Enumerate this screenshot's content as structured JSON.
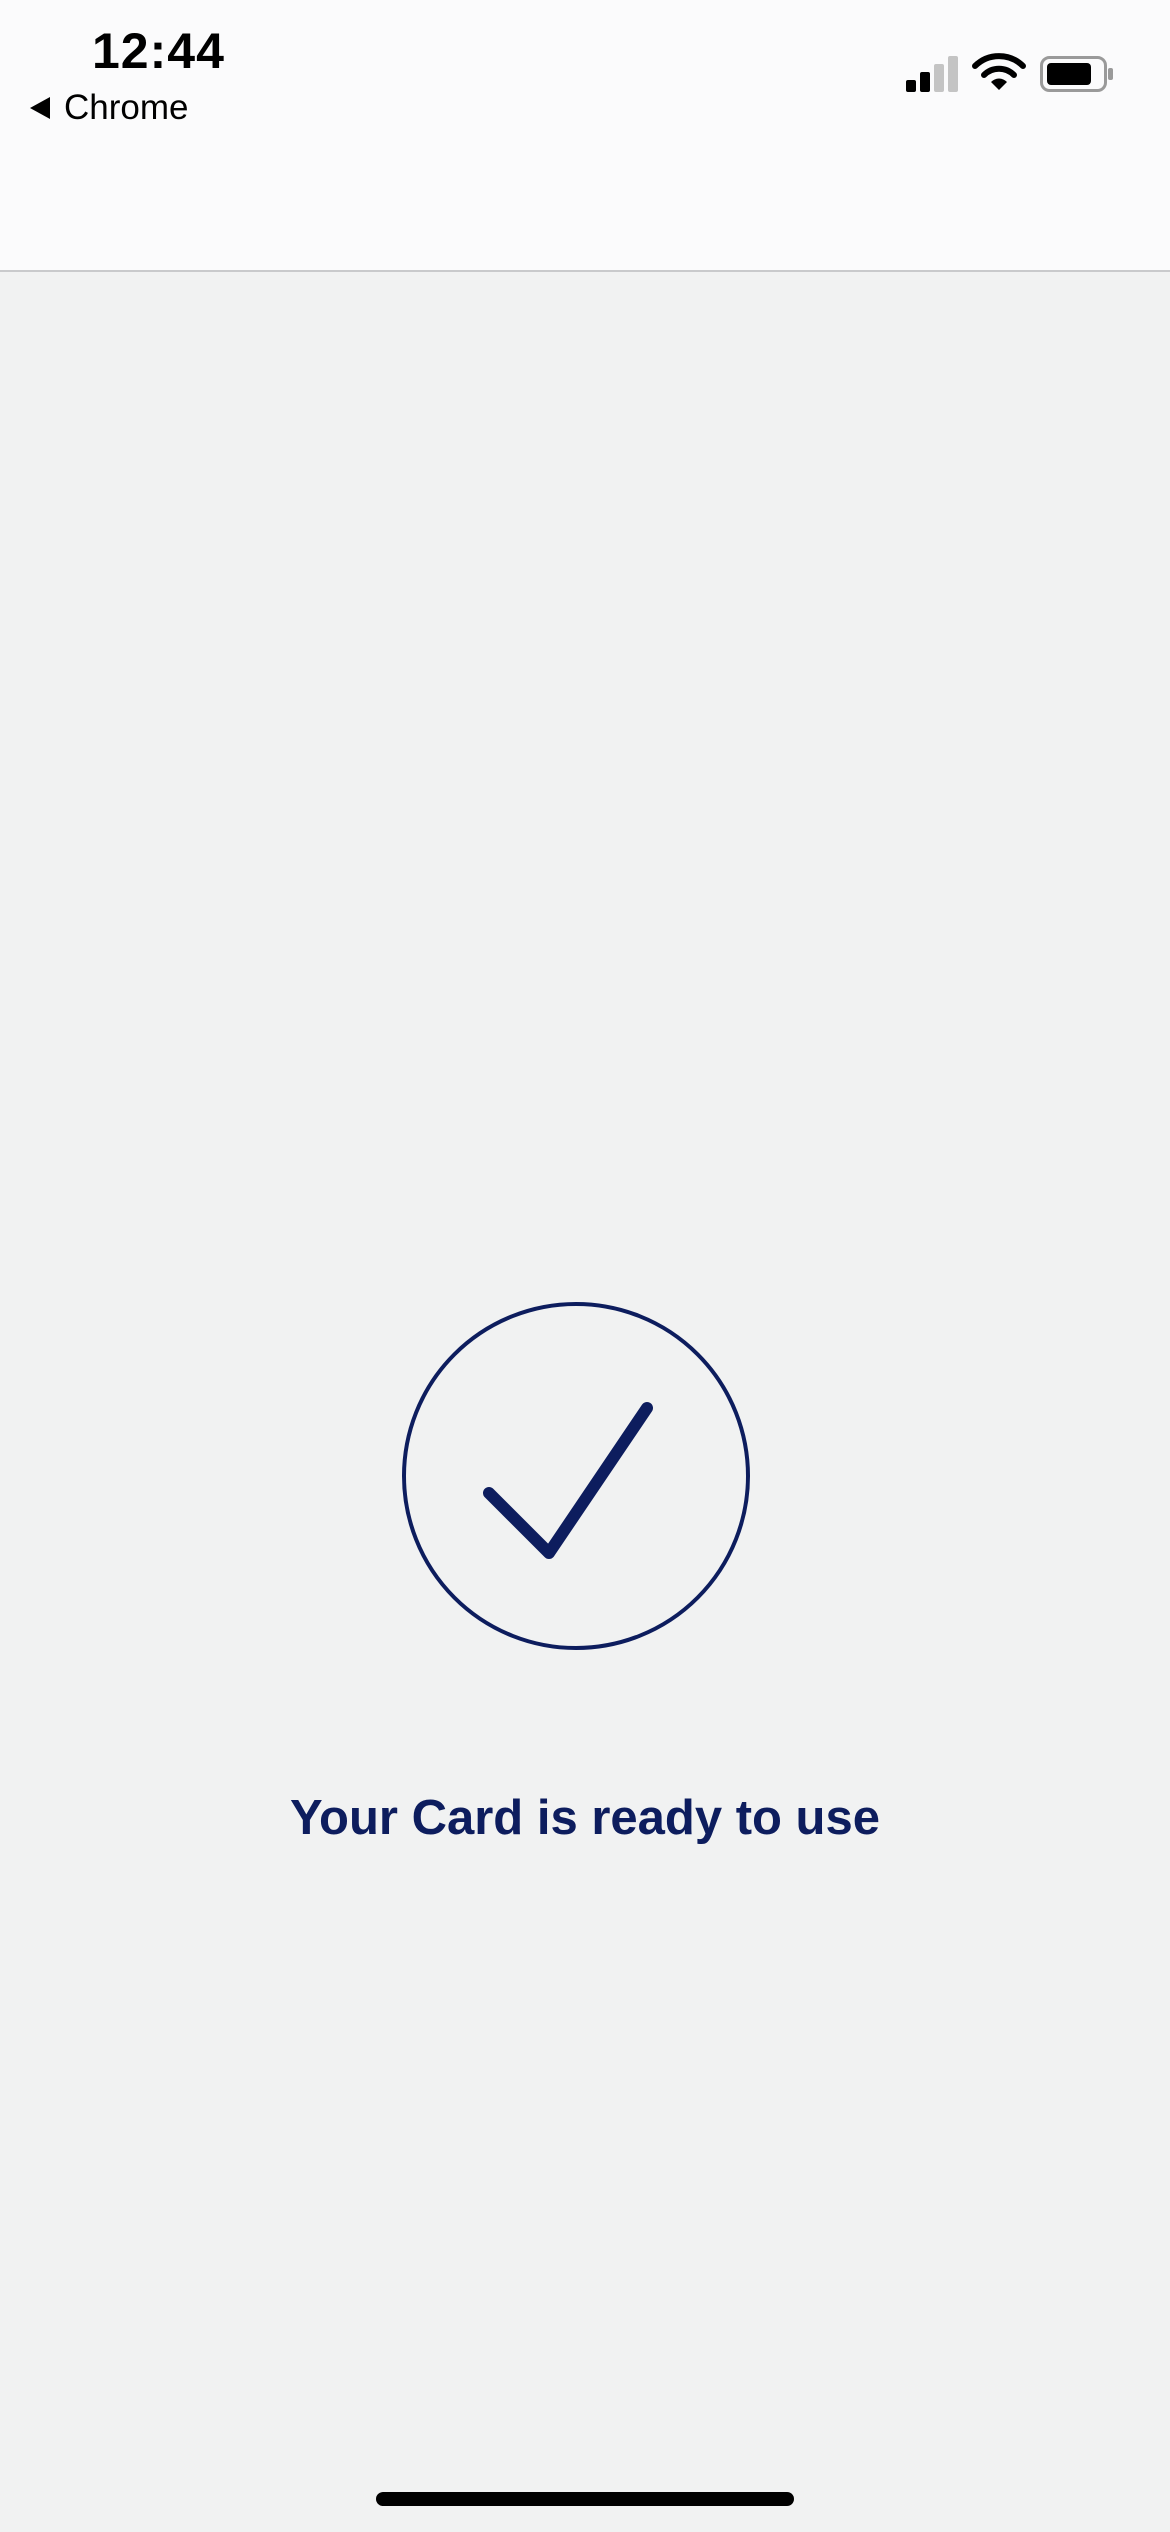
{
  "status_bar": {
    "time": "12:44",
    "back_label": "Chrome",
    "signal_icon": "cellular-signal-icon",
    "wifi_icon": "wifi-icon",
    "battery_icon": "battery-icon"
  },
  "main": {
    "success_icon": "checkmark-circle-icon",
    "message": "Your Card is ready to use"
  },
  "colors": {
    "accent": "#0d1d5e",
    "background": "#f1f2f2",
    "status_bar_background": "#fbfbfc"
  }
}
